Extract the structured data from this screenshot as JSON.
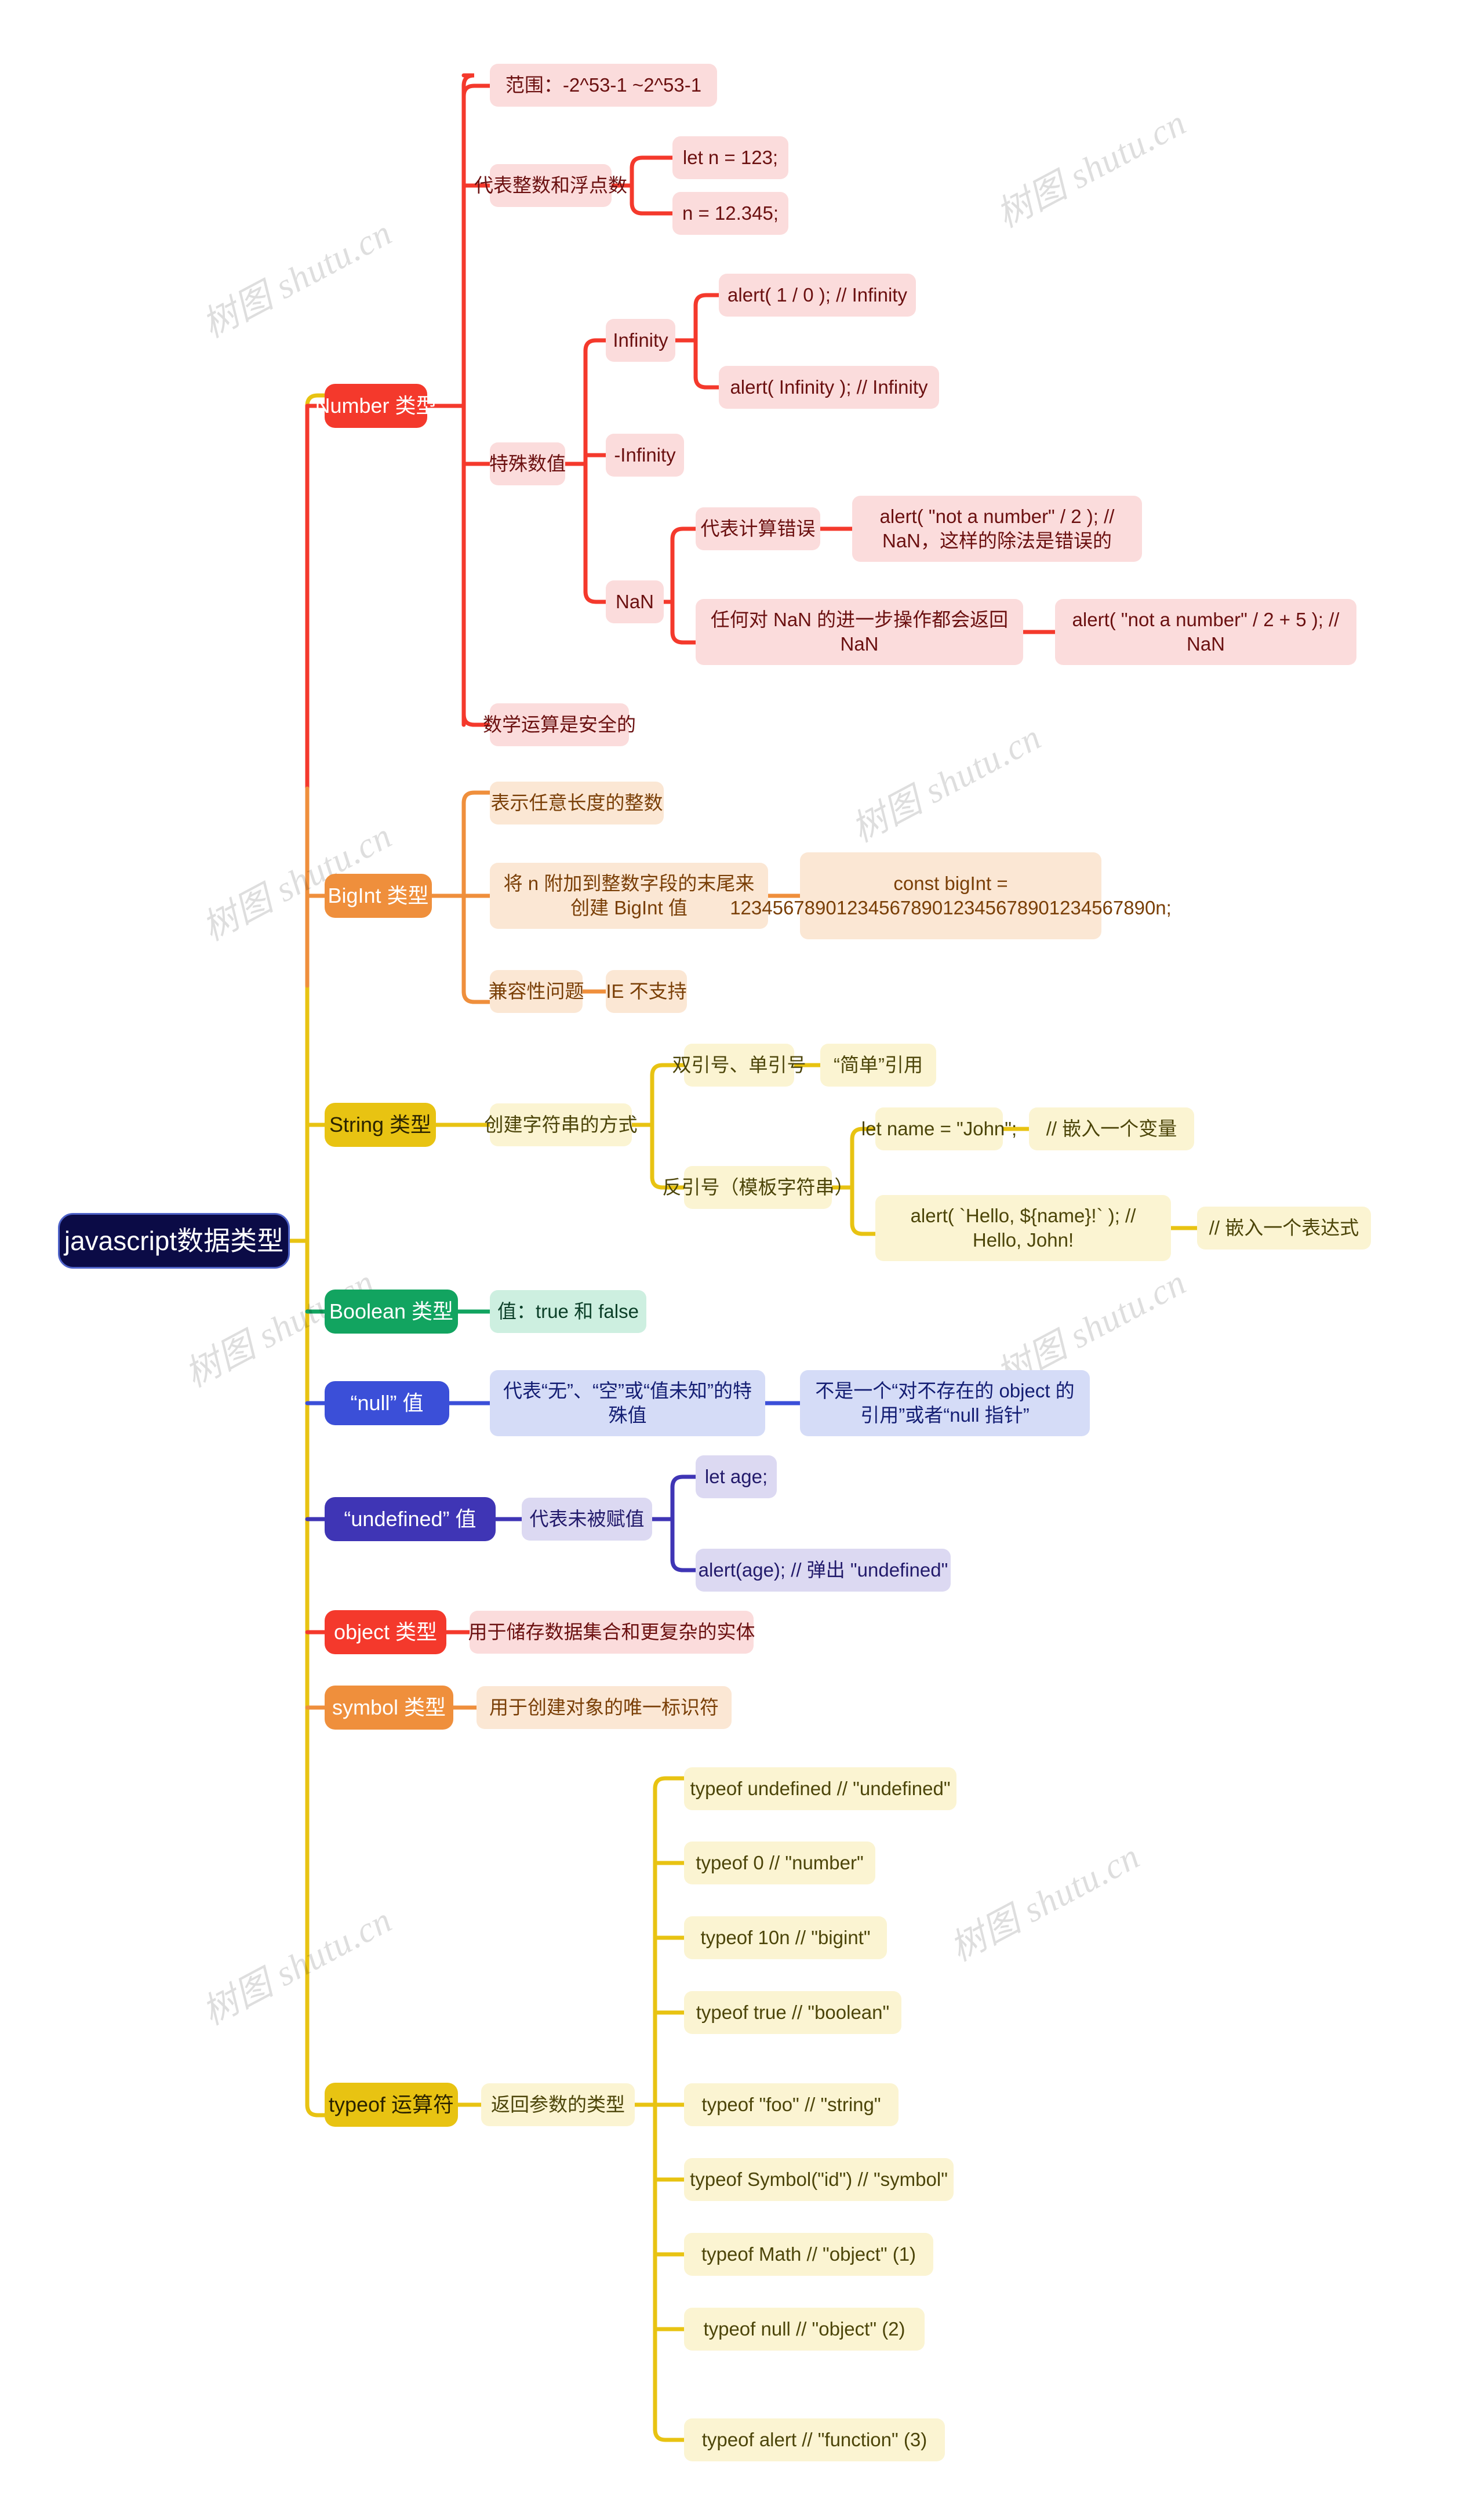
{
  "title": "javascript数据类型",
  "watermark_text": "树图 shutu.cn",
  "colors": {
    "root_bg": "#0b0b46",
    "root_border": "#4f63c9",
    "number": "#f4392c",
    "bigint": "#ef8f3c",
    "string": "#e8c312",
    "boolean": "#12a460",
    "null": "#3b4fd8",
    "undefined": "#3f35b5",
    "object": "#f4392c",
    "symbol": "#ef8f3c",
    "typeof": "#e8c312"
  },
  "root": {
    "label": "javascript数据类型"
  },
  "branches": [
    {
      "id": "number",
      "label": "Number 类型",
      "children": [
        {
          "id": "num-range",
          "label": "范围：-2^53-1 ~2^53-1"
        },
        {
          "id": "num-int-float",
          "label": "代表整数和浮点数",
          "children": [
            {
              "id": "num-let-n",
              "label": "let n = 123;"
            },
            {
              "id": "num-n-float",
              "label": "n = 12.345;"
            }
          ]
        },
        {
          "id": "num-special",
          "label": "特殊数值",
          "children": [
            {
              "id": "num-infinity",
              "label": "Infinity",
              "children": [
                {
                  "id": "num-inf-div",
                  "label": "alert( 1 / 0 ); // Infinity"
                },
                {
                  "id": "num-inf-lit",
                  "label": "alert( Infinity ); // Infinity"
                }
              ]
            },
            {
              "id": "num-neg-infinity",
              "label": "-Infinity"
            },
            {
              "id": "num-nan",
              "label": "NaN",
              "children": [
                {
                  "id": "num-nan-calcerr",
                  "label": "代表计算错误",
                  "children": [
                    {
                      "id": "num-nan-ex1",
                      "label": "alert( \"not a number\" / 2 ); // NaN，这样的除法是错误的"
                    }
                  ]
                },
                {
                  "id": "num-nan-sticky",
                  "label": "任何对 NaN 的进一步操作都会返回 NaN",
                  "children": [
                    {
                      "id": "num-nan-ex2",
                      "label": "alert( \"not a number\" / 2 + 5 ); // NaN"
                    }
                  ]
                }
              ]
            }
          ]
        },
        {
          "id": "num-safe-math",
          "label": "数学运算是安全的"
        }
      ]
    },
    {
      "id": "bigint",
      "label": "BigInt 类型",
      "children": [
        {
          "id": "big-any-length",
          "label": "表示任意长度的整数"
        },
        {
          "id": "big-append-n",
          "label": "将 n 附加到整数字段的末尾来创建 BigInt 值",
          "children": [
            {
              "id": "big-example",
              "label": "const bigInt = 1234567890123456789012345678901234567890n;"
            }
          ]
        },
        {
          "id": "big-compat",
          "label": "兼容性问题",
          "children": [
            {
              "id": "big-ie",
              "label": "IE 不支持"
            }
          ]
        }
      ]
    },
    {
      "id": "string",
      "label": "String 类型",
      "children": [
        {
          "id": "str-create",
          "label": "创建字符串的方式",
          "children": [
            {
              "id": "str-quotes",
              "label": "双引号、单引号",
              "children": [
                {
                  "id": "str-simple",
                  "label": "“简单”引用"
                }
              ]
            },
            {
              "id": "str-backtick",
              "label": "反引号（模板字符串）",
              "children": [
                {
                  "id": "str-let-name",
                  "label": "let name = \"John\";",
                  "children": [
                    {
                      "id": "str-embed-var",
                      "label": "// 嵌入一个变量"
                    }
                  ]
                },
                {
                  "id": "str-alert-hello",
                  "label": "alert( `Hello, ${name}!` ); // Hello, John!",
                  "children": [
                    {
                      "id": "str-embed-expr",
                      "label": "// 嵌入一个表达式"
                    }
                  ]
                }
              ]
            }
          ]
        }
      ]
    },
    {
      "id": "boolean",
      "label": "Boolean 类型",
      "children": [
        {
          "id": "bool-values",
          "label": "值：true 和 false"
        }
      ]
    },
    {
      "id": "null",
      "label": "“null” 值",
      "children": [
        {
          "id": "null-meaning",
          "label": "代表“无”、“空”或“值未知”的特殊值",
          "children": [
            {
              "id": "null-not-ptr",
              "label": "不是一个“对不存在的 object 的引用”或者“null 指针”"
            }
          ]
        }
      ]
    },
    {
      "id": "undefined",
      "label": "“undefined” 值",
      "children": [
        {
          "id": "undef-unassigned",
          "label": "代表未被赋值",
          "children": [
            {
              "id": "undef-let-age",
              "label": "let age;"
            },
            {
              "id": "undef-alert-age",
              "label": "alert(age); // 弹出 \"undefined\""
            }
          ]
        }
      ]
    },
    {
      "id": "object",
      "label": "object 类型",
      "children": [
        {
          "id": "obj-desc",
          "label": "用于储存数据集合和更复杂的实体"
        }
      ]
    },
    {
      "id": "symbol",
      "label": "symbol 类型",
      "children": [
        {
          "id": "sym-desc",
          "label": "用于创建对象的唯一标识符"
        }
      ]
    },
    {
      "id": "typeof",
      "label": "typeof 运算符",
      "children": [
        {
          "id": "typeof-returns",
          "label": "返回参数的类型",
          "children": [
            {
              "id": "to-undefined",
              "label": "typeof undefined // \"undefined\""
            },
            {
              "id": "to-0",
              "label": "typeof 0 // \"number\""
            },
            {
              "id": "to-10n",
              "label": "typeof 10n // \"bigint\""
            },
            {
              "id": "to-true",
              "label": "typeof true // \"boolean\""
            },
            {
              "id": "to-foo",
              "label": "typeof \"foo\" // \"string\""
            },
            {
              "id": "to-symbol",
              "label": "typeof Symbol(\"id\") // \"symbol\""
            },
            {
              "id": "to-math",
              "label": "typeof Math // \"object\" (1)"
            },
            {
              "id": "to-null",
              "label": "typeof null // \"object\" (2)"
            },
            {
              "id": "to-alert",
              "label": "typeof alert // \"function\" (3)"
            }
          ]
        }
      ]
    }
  ]
}
